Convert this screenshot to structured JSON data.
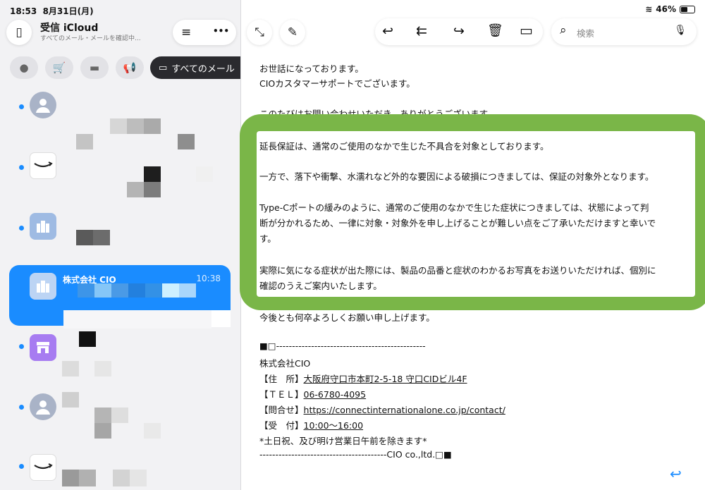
{
  "status_bar": {
    "time": "18:53",
    "date": "8月31日(月)",
    "battery": "46%"
  },
  "mailbox": {
    "title": "受信 iCloud",
    "subtitle": "すべてのメール・メールを確認中..."
  },
  "filters": {
    "all_label": "すべてのメール"
  },
  "search": {
    "placeholder": "検索"
  },
  "selected_mail": {
    "sender": "株式会社 CIO",
    "time": "10:38"
  },
  "icons": {
    "sidebar": "▯",
    "filter": "≡",
    "more": "•••",
    "collapse": "⤡",
    "compose": "✎",
    "reply": "↩",
    "reply_all": "⇇",
    "forward": "↪",
    "trash": "🗑",
    "folder": "▭",
    "search": "⌕",
    "mic": "🎙",
    "wifi": "≋",
    "person": "●",
    "cart": "🛒",
    "chat": "▬",
    "megaphone": "📢",
    "tray": "▭"
  },
  "email": {
    "greeting1": "お世話になっております。",
    "greeting2": "CIOカスタマーサポートでございます。",
    "thanks": "このたびはお問い合わせいただき、ありがとうございます。",
    "p1": "延長保証は、通常のご使用のなかで生じた不具合を対象としております。",
    "p2": "一方で、落下や衝撃、水濡れなど外的な要因による破損につきましては、保証の対象外となります。",
    "p3a": "Type-Cポートの緩みのように、通常のご使用のなかで生じた症状につきましては、状態によって判",
    "p3b": "断が分かれるため、一律に対象・対象外を申し上げることが難しい点をご了承いただけますと幸いで",
    "p3c": "す。",
    "p4a": "実際に気になる症状が出た際には、製品の品番と症状のわかるお写真をお送りいただければ、個別に",
    "p4b": "確認のうえご案内いたします。",
    "closing": "今後とも何卒よろしくお願い申し上げます。",
    "sig_line": "■□-----------------------------------------------",
    "company": "株式会社CIO",
    "addr_label": "【住　所】",
    "addr_value": "大阪府守口市本町2-5-18 守口CIDビル4F",
    "tel_label": "【ＴＥＬ】",
    "tel_value": "06-6780-4095",
    "contact_label": "【問合せ】",
    "contact_value": "https://connectinternationalone.co.jp/contact/",
    "hours_label": "【受　付】",
    "hours_value": "10:00〜16:00",
    "note": "*土日祝、及び明け営業日午前を除きます*",
    "footer": "----------------------------------------CIO co.,ltd.□■"
  },
  "colors": {
    "accent": "#1a8cff",
    "highlight_frame": "#7ab648"
  }
}
